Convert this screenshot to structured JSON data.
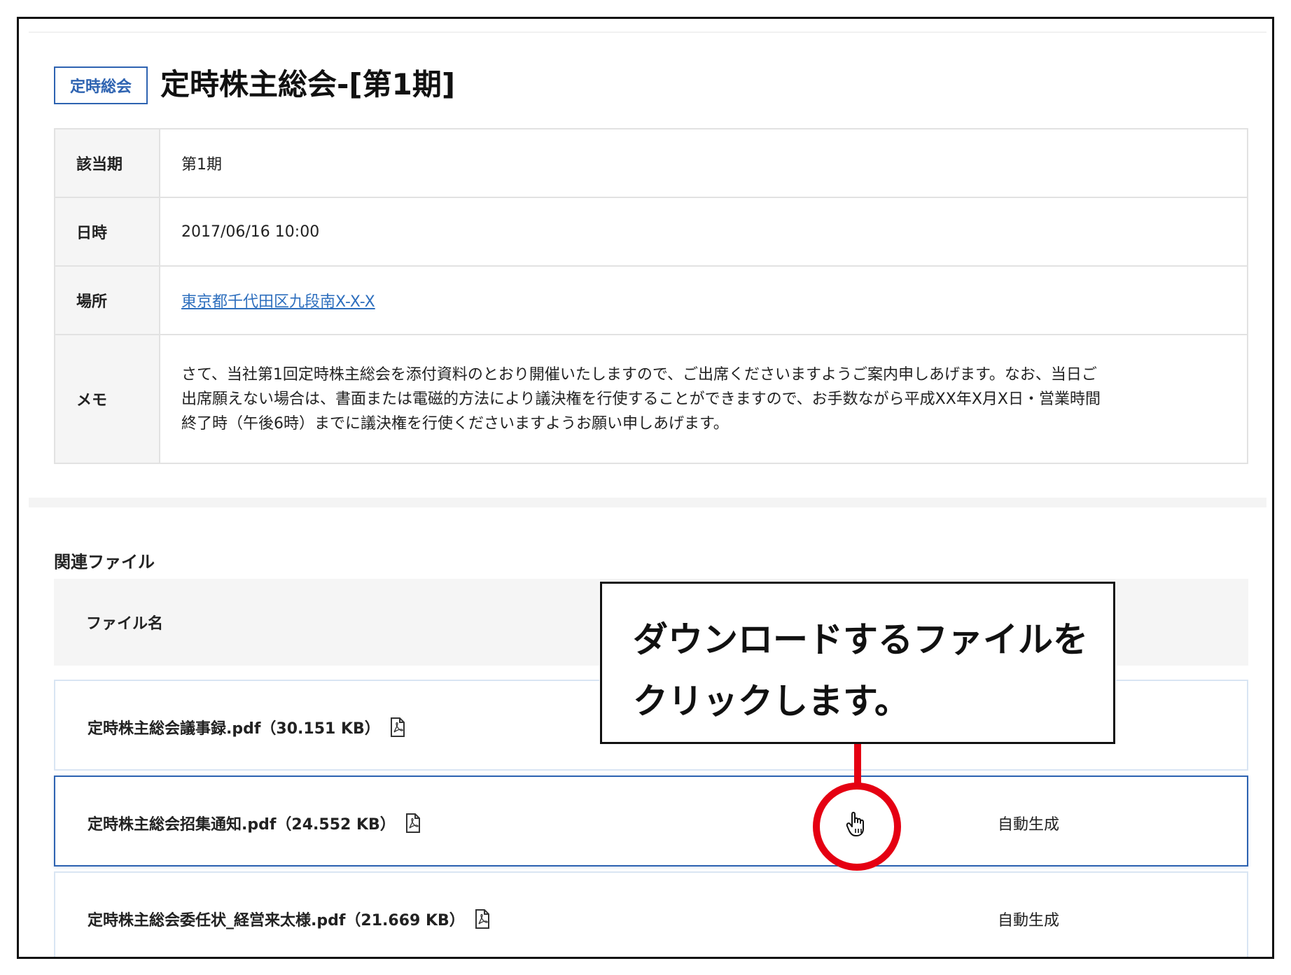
{
  "header": {
    "tag": "定時総会",
    "title": "定時株主総会-[第1期]"
  },
  "details": {
    "period_label": "該当期",
    "period_value": "第1期",
    "datetime_label": "日時",
    "datetime_value": "2017/06/16 10:00",
    "place_label": "場所",
    "place_value": "東京都千代田区九段南X-X-X",
    "memo_label": "メモ",
    "memo_line1": "さて、当社第1回定時株主総会を添付資料のとおり開催いたしますので、ご出席くださいますようご案内申しあげます。なお、当日ご",
    "memo_line2": "出席願えない場合は、書面または電磁的方法により議決権を行使することができますので、お手数ながら平成XX年X月X日・営業時間",
    "memo_line3": "終了時（午後6時）までに議決権を行使くださいますようお願い申しあげます。"
  },
  "files": {
    "section_title": "関連ファイル",
    "column_name": "ファイル名",
    "rows": [
      {
        "name": "定時株主総会議事録.pdf（30.151 KB）",
        "status": ""
      },
      {
        "name": "定時株主総会招集通知.pdf（24.552 KB）",
        "status": "自動生成"
      },
      {
        "name": "定時株主総会委任状_経営来太様.pdf（21.669 KB）",
        "status": "自動生成"
      }
    ]
  },
  "callout": {
    "line1": "ダウンロードするファイルを",
    "line2": "クリックします。"
  },
  "colors": {
    "accent": "#2e63b1",
    "link": "#2e6fbe",
    "highlight_red": "#e50012"
  }
}
